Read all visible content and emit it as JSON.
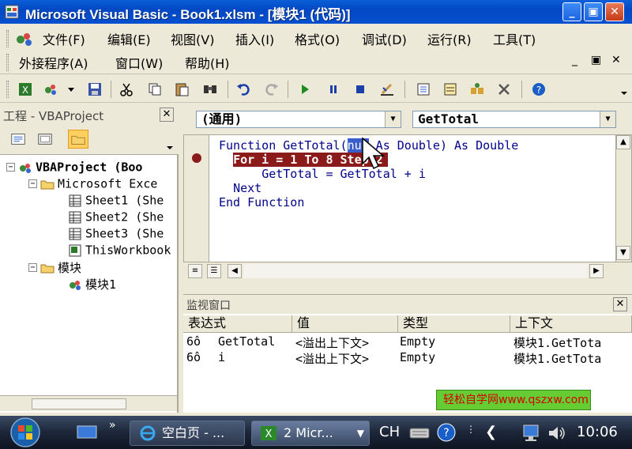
{
  "window": {
    "title": "Microsoft Visual Basic - Book1.xlsm - [模块1 (代码)]",
    "min": "_",
    "max": "▣",
    "close": "✕"
  },
  "menu": {
    "row1": [
      "文件(F)",
      "编辑(E)",
      "视图(V)",
      "插入(I)",
      "格式(O)",
      "调试(D)",
      "运行(R)",
      "工具(T)"
    ],
    "row2": [
      "外接程序(A)",
      "窗口(W)",
      "帮助(H)"
    ],
    "mdi_min": "_",
    "mdi_restore": "▣",
    "mdi_close": "✕"
  },
  "project": {
    "title": "工程 - VBAProject",
    "close": "✕",
    "tree": [
      {
        "label": "VBAProject (Boo",
        "expander": "−",
        "bold": true
      },
      {
        "label": "Microsoft Exce",
        "expander": "−"
      },
      {
        "label": "Sheet1 (She"
      },
      {
        "label": "Sheet2 (She"
      },
      {
        "label": "Sheet3 (She"
      },
      {
        "label": "ThisWorkbook"
      },
      {
        "label": "模块",
        "expander": "−"
      },
      {
        "label": "模块1"
      }
    ]
  },
  "code": {
    "object_combo": "(通用)",
    "proc_combo": "GetTotal",
    "lines": {
      "l1_kw1": "Function",
      "l1_name": " GetTotal(",
      "l1_sel": "num",
      "l1_rest1": " As ",
      "l1_kw2": "Double",
      "l1_rest2": ") ",
      "l1_kw3": "As Double",
      "l2": "For i = 1 To 8 Step 2",
      "l3": "GetTotal = GetTotal + i",
      "l4": "Next",
      "l5": "End Function"
    }
  },
  "watch": {
    "title": "监视窗口",
    "close": "✕",
    "columns": [
      "表达式",
      "值",
      "类型",
      "上下文"
    ],
    "rows": [
      {
        "expr": "GetTotal",
        "value": "<溢出上下文>",
        "type": "Empty",
        "context": "模块1.GetTota"
      },
      {
        "expr": "i",
        "value": "<溢出上下文>",
        "type": "Empty",
        "context": "模块1.GetTota"
      }
    ],
    "watermark": "轻松自学网www.qszxw.com"
  },
  "taskbar": {
    "task1": "空白页 - ...",
    "task2": "2 Micr...",
    "lang": "CH",
    "time": "10:06"
  },
  "colors": {
    "titlebar": "#0348c4",
    "breakpoint": "#8b1a1a",
    "keyword": "#00008b",
    "watermark_bg": "#66cc33"
  }
}
